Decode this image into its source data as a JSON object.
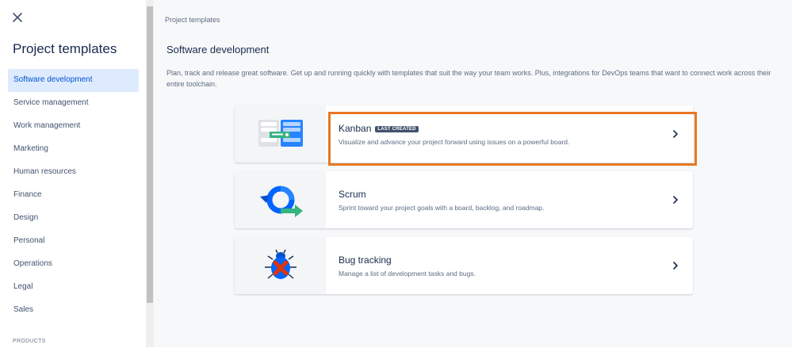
{
  "sidebar": {
    "close_icon": "close-icon",
    "title": "Project templates",
    "items": [
      {
        "label": "Software development",
        "active": true
      },
      {
        "label": "Service management"
      },
      {
        "label": "Work management"
      },
      {
        "label": "Marketing"
      },
      {
        "label": "Human resources"
      },
      {
        "label": "Finance"
      },
      {
        "label": "Design"
      },
      {
        "label": "Personal"
      },
      {
        "label": "Operations"
      },
      {
        "label": "Legal"
      },
      {
        "label": "Sales"
      }
    ],
    "products_heading": "PRODUCTS"
  },
  "main": {
    "breadcrumb": "Project templates",
    "section_title": "Software development",
    "section_description": "Plan, track and release great software. Get up and running quickly with templates that suit the way your team works. Plus, integrations for DevOps teams that want to connect work across their entire toolchain.",
    "templates": [
      {
        "title": "Kanban",
        "badge": "LAST CREATED",
        "description": "Visualize and advance your project forward using issues on a powerful board.",
        "illustration": "kanban-board-illustration",
        "highlighted": true
      },
      {
        "title": "Scrum",
        "description": "Sprint toward your project goals with a board, backlog, and roadmap.",
        "illustration": "scrum-cycle-illustration"
      },
      {
        "title": "Bug tracking",
        "description": "Manage a list of development tasks and bugs.",
        "illustration": "bug-illustration"
      }
    ]
  },
  "colors": {
    "accent": "#0052cc",
    "active_bg": "#deebff",
    "highlight_border": "#e87722",
    "badge_bg": "#42526e",
    "text_primary": "#172b4d",
    "text_secondary": "#5e6c84"
  }
}
